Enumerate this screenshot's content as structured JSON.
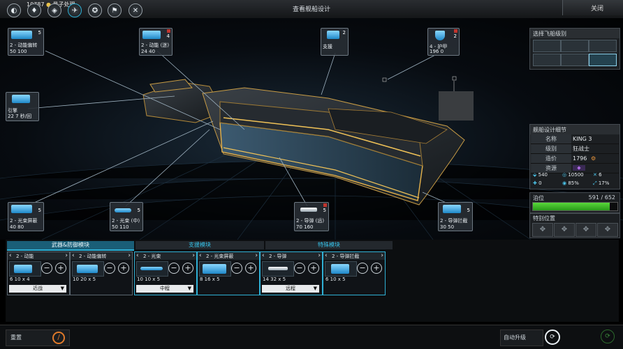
{
  "topbar": {
    "credits": "10787",
    "credits_label": "量子处理",
    "title": "查看舰船设计",
    "close_label": "关闭"
  },
  "modules": {
    "top_left": {
      "name": "2 - 动能偏转",
      "stats": "50  100",
      "count": "5"
    },
    "top_mid": {
      "name": "2 - 动能 (迷)",
      "stats": "24  40",
      "count": "4"
    },
    "support": {
      "name": "支援",
      "count": "2"
    },
    "shield": {
      "name": "4 - 护甲",
      "stats": "196  0",
      "count": "2"
    },
    "engine": {
      "name": "引擎",
      "stats": "22    7 秒/回"
    },
    "bl_shield": {
      "name": "2 - 光束屏蔽",
      "stats": "40  80",
      "count": "5"
    },
    "beam": {
      "name": "2 - 光束 (中)",
      "stats": "50  110",
      "count": "5"
    },
    "missile": {
      "name": "2 - 导弹 (远)",
      "stats": "70  160",
      "count": "5"
    },
    "intercept": {
      "name": "2 - 导弹拦截",
      "stats": "30  50",
      "count": "5"
    }
  },
  "class_panel": {
    "title": "选择飞船级别"
  },
  "spec_panel": {
    "title": "舰船设计细节",
    "rows": [
      {
        "k": "名称",
        "v": "KING 3"
      },
      {
        "k": "级别",
        "v": "狂战士"
      },
      {
        "k": "造价",
        "v": "1796"
      },
      {
        "k": "资源",
        "v": ""
      }
    ],
    "stats": [
      "540",
      "10500",
      "6",
      "0",
      "85%",
      "17%"
    ]
  },
  "berth": {
    "label": "泊位",
    "value": "591 / 652",
    "fill": 0.906
  },
  "special": {
    "label": "特别位置"
  },
  "tabs": [
    "武器&防御模块",
    "支援模块",
    "特殊模块"
  ],
  "slots": [
    {
      "label": "2 - 动能",
      "stats": "6   10   x 4",
      "dd": "近战"
    },
    {
      "label": "2 - 动能偏转",
      "stats": "10   20   x 5",
      "dd": ""
    },
    {
      "label": "2 - 光束",
      "stats": "10   10   x 5",
      "dd": "中程"
    },
    {
      "label": "2 - 光束屏蔽",
      "stats": "8   16   x 5",
      "dd": ""
    },
    {
      "label": "2 - 导弹",
      "stats": "14   32   x 5",
      "dd": "远程"
    },
    {
      "label": "2 - 导弹拦截",
      "stats": "6   10   x 5",
      "dd": ""
    }
  ],
  "bottom": {
    "reset": "重置",
    "auto_upgrade": "自动升级"
  },
  "colors": {
    "accent": "#2fb1d6",
    "berth_green": "#3fbf2a",
    "red_badge": "#c0342d"
  }
}
